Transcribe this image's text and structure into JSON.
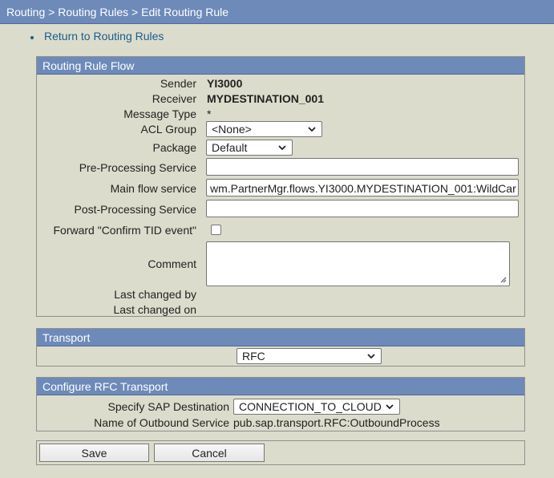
{
  "breadcrumb": "Routing > Routing Rules > Edit Routing Rule",
  "return_link": "Return to Routing Rules",
  "flow": {
    "header": "Routing Rule Flow",
    "sender_label": "Sender",
    "sender_value": "YI3000",
    "receiver_label": "Receiver",
    "receiver_value": "MYDESTINATION_001",
    "message_type_label": "Message Type",
    "message_type_value": "*",
    "acl_group_label": "ACL Group",
    "acl_group_value": "<None>",
    "package_label": "Package",
    "package_value": "Default",
    "pre_processing_label": "Pre-Processing Service",
    "pre_processing_value": "",
    "main_flow_label": "Main flow service",
    "main_flow_value": "wm.PartnerMgr.flows.YI3000.MYDESTINATION_001:WildCar",
    "post_processing_label": "Post-Processing Service",
    "post_processing_value": "",
    "forward_confirm_label": "Forward \"Confirm TID event\"",
    "forward_confirm_checked": false,
    "comment_label": "Comment",
    "comment_value": "",
    "last_changed_by_label": "Last changed by",
    "last_changed_on_label": "Last changed on"
  },
  "transport": {
    "header": "Transport",
    "value": "RFC"
  },
  "rfc": {
    "header": "Configure RFC Transport",
    "sap_destination_label": "Specify SAP Destination",
    "sap_destination_value": "CONNECTION_TO_CLOUD",
    "outbound_service_label": "Name of Outbound Service",
    "outbound_service_value": "pub.sap.transport.RFC:OutboundProcess"
  },
  "actions": {
    "save_label": "Save",
    "cancel_label": "Cancel"
  },
  "colors": {
    "header_bg": "#6d8ab9",
    "page_bg": "#dcdccc",
    "link": "#1a5c8e"
  },
  "icons": {
    "dropdown": "chevron-down-icon",
    "resize": "resize-grip-icon"
  }
}
